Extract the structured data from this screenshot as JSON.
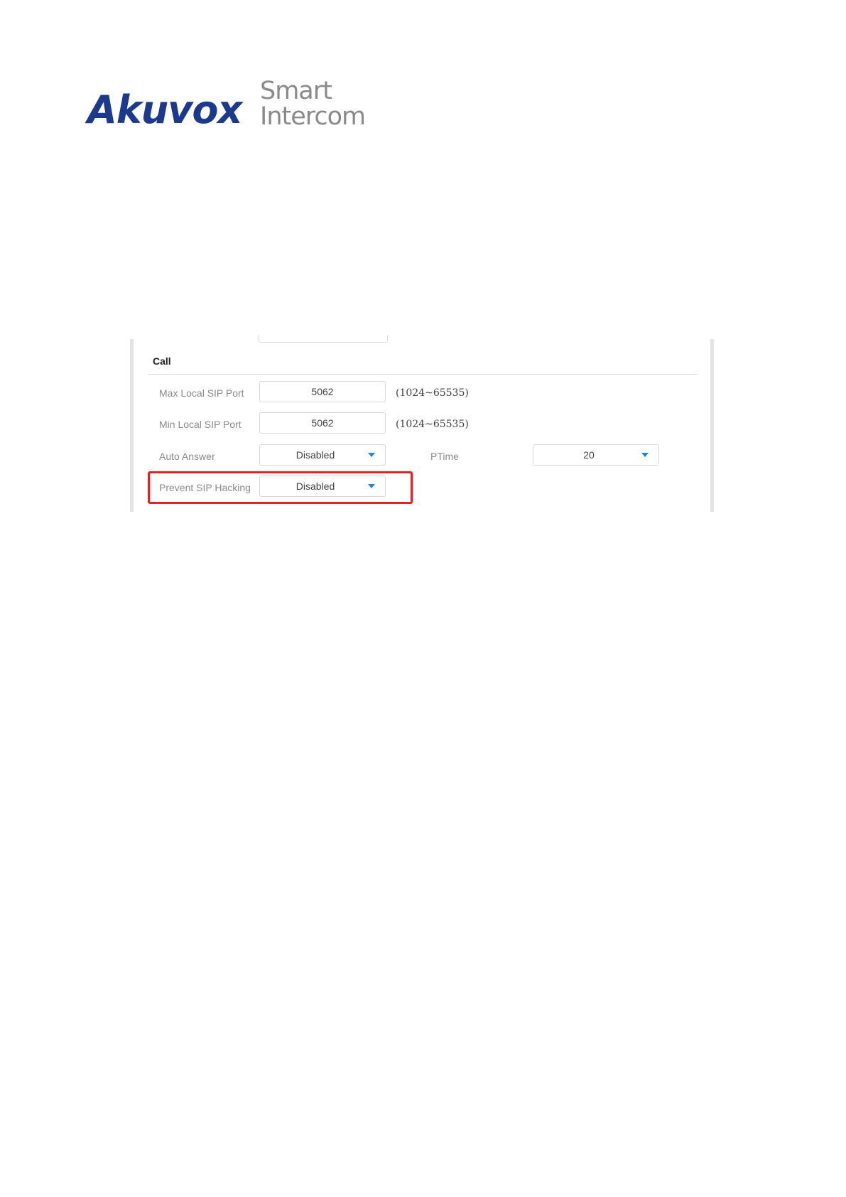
{
  "logo": {
    "brand": "Akuvox",
    "tagline_line1": "Smart",
    "tagline_line2": "Intercom",
    "brand_color": "#1b3a8f",
    "tagline_color": "#8a8a8a"
  },
  "call_section": {
    "title": "Call",
    "rows": [
      {
        "label": "Max Local SIP Port",
        "value": "5062",
        "range": "(1024~65535)"
      },
      {
        "label": "Min Local SIP Port",
        "value": "5062",
        "range": "(1024~65535)"
      }
    ],
    "auto_answer": {
      "label": "Auto Answer",
      "selected": "Disabled"
    },
    "ptime": {
      "label": "PTime",
      "selected": "20"
    },
    "prevent_sip_hacking": {
      "label": "Prevent SIP Hacking",
      "selected": "Disabled"
    }
  },
  "colors": {
    "highlight": "#e02424",
    "caret": "#1e88d8"
  }
}
